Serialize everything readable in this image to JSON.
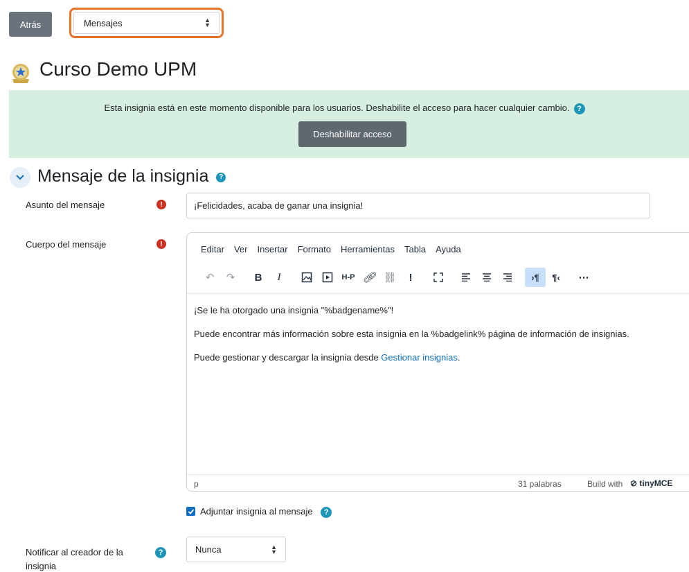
{
  "nav": {
    "back_label": "Atrás",
    "section_select_value": "Mensajes"
  },
  "course": {
    "title": "Curso Demo UPM"
  },
  "alert": {
    "text": "Esta insignia está en este momento disponible para los usuarios. Deshabilite el acceso para hacer cualquier cambio.",
    "button_label": "Deshabilitar acceso"
  },
  "section": {
    "title": "Mensaje de la insignia"
  },
  "form": {
    "subject_label": "Asunto del mensaje",
    "subject_value": "¡Felicidades, acaba de ganar una insignia!",
    "body_label": "Cuerpo del mensaje",
    "attach_label": "Adjuntar insignia al mensaje",
    "attach_checked": true,
    "notify_label_line1": "Notificar al creador de la",
    "notify_label_line2": "insignia",
    "notify_value": "Nunca"
  },
  "editor": {
    "menu": [
      "Editar",
      "Ver",
      "Insertar",
      "Formato",
      "Herramientas",
      "Tabla",
      "Ayuda"
    ],
    "paragraph1": "¡Se le ha otorgado una insignia \"%badgename%\"!",
    "paragraph2": "Puede encontrar más información sobre esta insignia en la %badgelink% página de información de insignias.",
    "paragraph3_prefix": "Puede gestionar y descargar la insignia desde ",
    "paragraph3_link": "Gestionar insignias",
    "paragraph3_suffix": ".",
    "status_path": "p",
    "word_count": "31 palabras",
    "build_with": "Build with",
    "brand": "tinyMCE"
  },
  "colors": {
    "accent": "#0f6cbf",
    "alert_bg": "#d7efe0",
    "highlight": "#e8742b",
    "required": "#ca3120",
    "help": "#1f96b9"
  }
}
